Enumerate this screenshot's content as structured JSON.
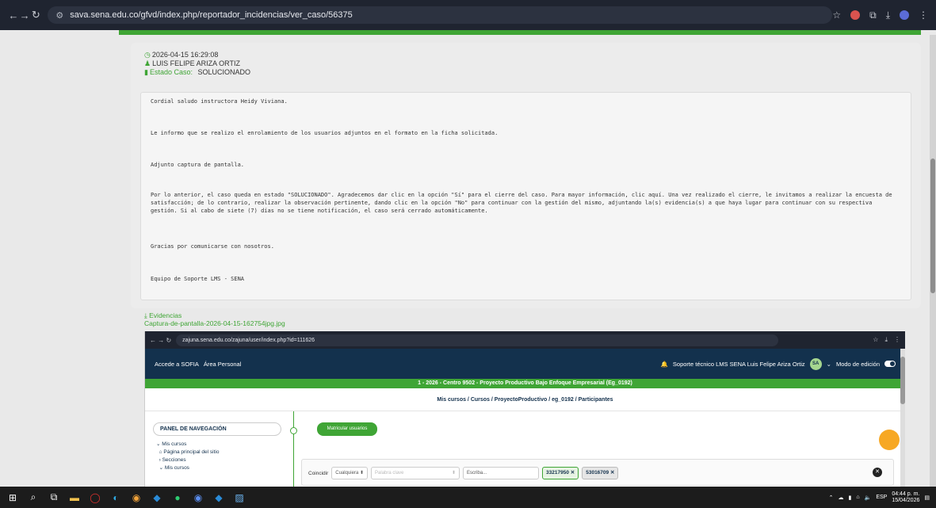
{
  "browser": {
    "url": "sava.sena.edu.co/gfvd/index.php/reportador_incidencias/ver_caso/56375"
  },
  "case": {
    "date": "2026-04-15 16:29:08",
    "user": "LUIS FELIPE ARIZA ORTIZ",
    "status_label": "Estado Caso:",
    "status_value": "SOLUCIONADO",
    "message": {
      "greeting": "Cordial saludo instructora Heidy Viviana.",
      "p1": "Le informo que se realizo el enrolamiento de los usuarios adjuntos en el formato en la ficha solicitada.",
      "p2": "Adjunto captura de pantalla.",
      "p3": "Por lo anterior, el caso queda en estado \"SOLUCIONADO\". Agradecemos dar clic en la opción \"Sí\" para el cierre del caso. Para mayor información, clic aquí. Una vez realizado el cierre, le invitamos a realizar la encuesta de satisfacción; de lo contrario, realizar la observación pertinente, dando clic en la opción \"No\" para continuar con la gestión del mismo, adjuntando la(s) evidencia(s) a que haya lugar para continuar con su respectiva gestión. Si al cabo de siete (7) días no se tiene notificación, el caso será cerrado automáticamente.",
      "p4": "Gracias por comunicarse con nosotros.",
      "signature": "Equipo de Soporte LMS - SENA"
    }
  },
  "evidence": {
    "label": "Evidencias",
    "file": "Captura-de-pantalla-2026-04-15-162754jpg.jpg"
  },
  "screenshot": {
    "url": "zajuna.sena.edu.co/zajuna/user/index.php?id=111626",
    "nav_left": [
      "Accede a SOFIA",
      "Área Personal"
    ],
    "user_name": "Soporte técnico LMS SENA Luis Felipe Ariza Ortiz",
    "avatar": "SA",
    "edit_mode": "Modo de edición",
    "course_title": "1 - 2026 - Centro 9502 - Proyecto Productivo Bajo Enfoque Empresarial (Eg_0192)",
    "breadcrumbs": "Mis cursos / Cursos / ProyectoProductivo / eg_0192 / Participantes",
    "panel_title": "PANEL DE NAVEGACIÓN",
    "panel_items": [
      "Mis cursos",
      "Página principal del sitio",
      "Secciones",
      "Mis cursos"
    ],
    "enroll_button": "Matricular usuarios",
    "filter": {
      "match_label": "Coincidir",
      "match_value": "Cualquiera",
      "keyword_placeholder": "Palabra clave",
      "type_placeholder": "Escriba...",
      "chips": [
        "33217950",
        "53016709"
      ]
    }
  },
  "taskbar": {
    "lang": "ESP",
    "time": "04:44 p. m.",
    "date": "15/04/2026"
  }
}
